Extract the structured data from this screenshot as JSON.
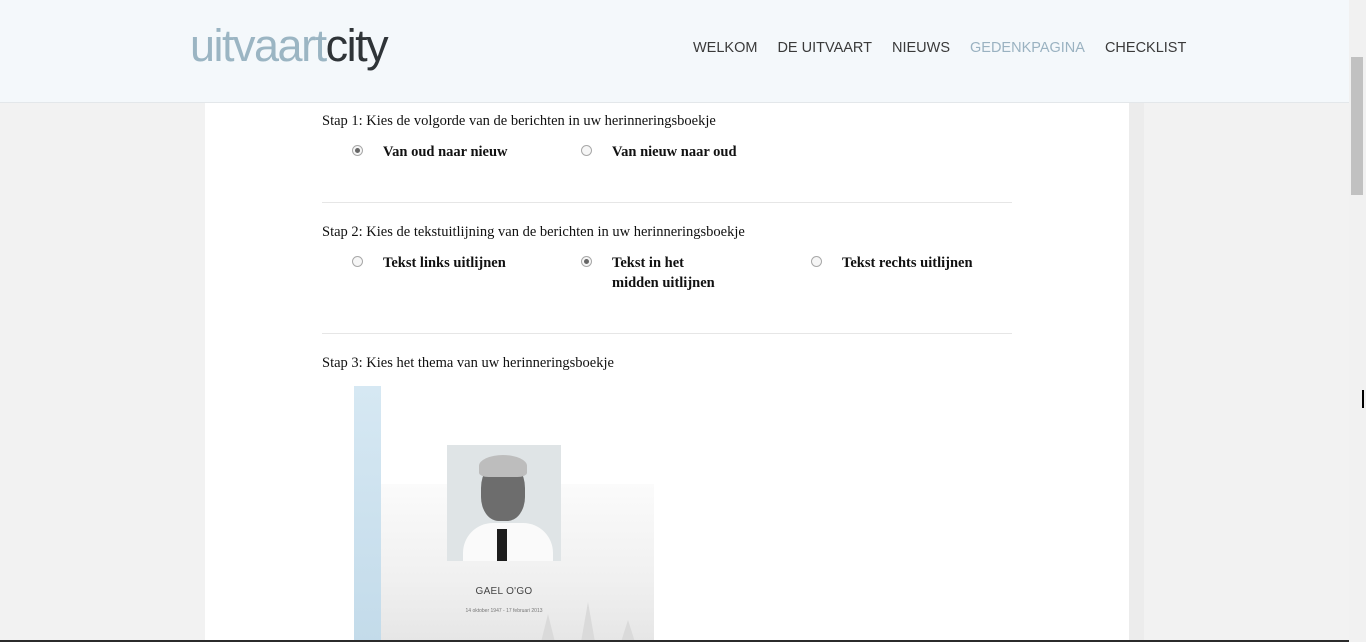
{
  "header": {
    "logo_part1": "uitvaart",
    "logo_part2": "city",
    "nav": [
      "WELKOM",
      "DE UITVAART",
      "NIEUWS",
      "GEDENKPAGINA",
      "CHECKLIST"
    ],
    "active_nav": "GEDENKPAGINA"
  },
  "step1": {
    "label": "Stap 1: Kies de volgorde van de berichten in uw herinneringsboekje",
    "options": [
      {
        "label": "Van oud naar nieuw",
        "checked": true
      },
      {
        "label": "Van nieuw naar oud",
        "checked": false
      }
    ]
  },
  "step2": {
    "label": "Stap 2: Kies de tekstuitlijning van de berichten in uw herinneringsboekje",
    "options": [
      {
        "label": "Tekst links uitlijnen",
        "checked": false
      },
      {
        "label": "Tekst in het midden uitlijnen",
        "checked": true
      },
      {
        "label": "Tekst rechts uitlijnen",
        "checked": false
      }
    ]
  },
  "step3": {
    "label": "Stap 3: Kies het thema van uw herinneringsboekje",
    "theme_preview": {
      "name": "GAEL O'GO",
      "dates": "14 oktober 1947 - 17 februari 2013"
    }
  },
  "colors": {
    "logo_light": "#9bb5c3",
    "logo_dark": "#2f3438",
    "nav_active": "#9ab2c1",
    "header_bg": "#f4f8fb"
  }
}
